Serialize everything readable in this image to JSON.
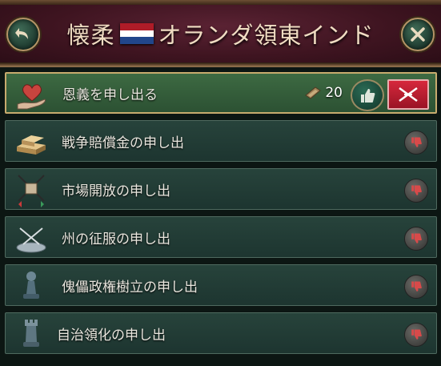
{
  "header": {
    "title_prefix": "懐柔",
    "title_suffix": "オランダ領東インド",
    "flag_colors": [
      "#ae1c28",
      "#ffffff",
      "#21468b"
    ],
    "back_icon": "back-arrow-icon",
    "close_icon": "close-icon"
  },
  "rows": [
    {
      "label": "恩義を申し出る",
      "icon": "heart-hand-icon",
      "cost": "20",
      "cost_icon": "favor-token-icon",
      "selected": true
    },
    {
      "label": "戦争賠償金の申し出",
      "icon": "gold-bars-icon"
    },
    {
      "label": "市場開放の申し出",
      "icon": "trade-crate-icon"
    },
    {
      "label": "州の征服の申し出",
      "icon": "crossed-swords-icon"
    },
    {
      "label": "傀儡政権樹立の申し出",
      "icon": "pawn-icon"
    },
    {
      "label": "自治領化の申し出",
      "icon": "rook-icon"
    }
  ],
  "colors": {
    "accent_gold": "#c7ab6e",
    "reject_red": "#c41e33",
    "approve_green": "#2c6b55"
  }
}
